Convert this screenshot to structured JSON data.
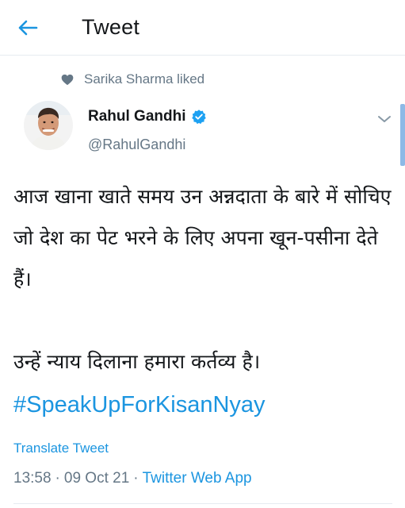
{
  "header": {
    "title": "Tweet",
    "back_icon": "arrow-left-icon"
  },
  "social_context": {
    "text": "Sarika Sharma liked",
    "icon": "heart-icon"
  },
  "author": {
    "name": "Rahul Gandhi",
    "handle": "@RahulGandhi",
    "verified": true
  },
  "tweet": {
    "body": "आज खाना खाते समय उन अन्नदाता के बारे में सोचिए जो देश का पेट भरने के लिए अपना खून-पसीना देते हैं।\n\nउन्हें न्याय दिलाना हमारा कर्तव्य है।",
    "hashtag": "#SpeakUpForKisanNyay",
    "translate_label": "Translate Tweet",
    "time": "13:58",
    "date": "09 Oct 21",
    "source": "Twitter Web App",
    "separator": "·"
  },
  "colors": {
    "accent": "#1b95e0",
    "secondary_text": "#657786",
    "primary_text": "#14171a"
  }
}
